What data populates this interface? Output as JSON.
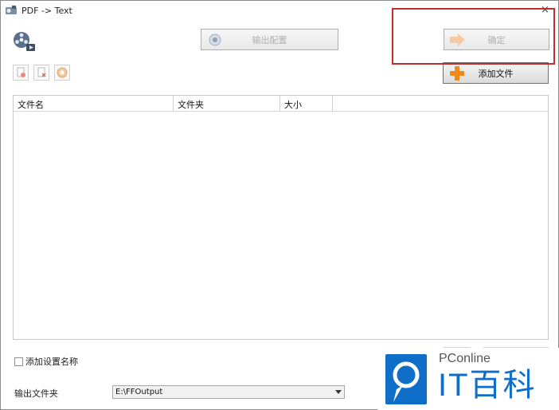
{
  "window": {
    "title": "PDF -> Text",
    "close_glyph": "×"
  },
  "toolbar": {
    "config_label": "输出配置",
    "ok_label": "确定",
    "add_file_label": "添加文件",
    "tools": [
      {
        "icon": "add-doc-icon"
      },
      {
        "icon": "remove-doc-icon"
      },
      {
        "icon": "clear-icon"
      }
    ]
  },
  "file_list": {
    "columns": [
      "文件名",
      "文件夹",
      "大小"
    ]
  },
  "options": {
    "add_setting_name_label": "添加设置名称"
  },
  "output": {
    "folder_label": "输出文件夹",
    "folder_value": "E:\\FFOutput"
  },
  "watermark": {
    "brand": "PConline",
    "title": "IT百科"
  },
  "colors": {
    "highlight_box": "#c0302f",
    "watermark_blue": "#0e6ec8",
    "add_icon_orange": "#f08a1c"
  }
}
